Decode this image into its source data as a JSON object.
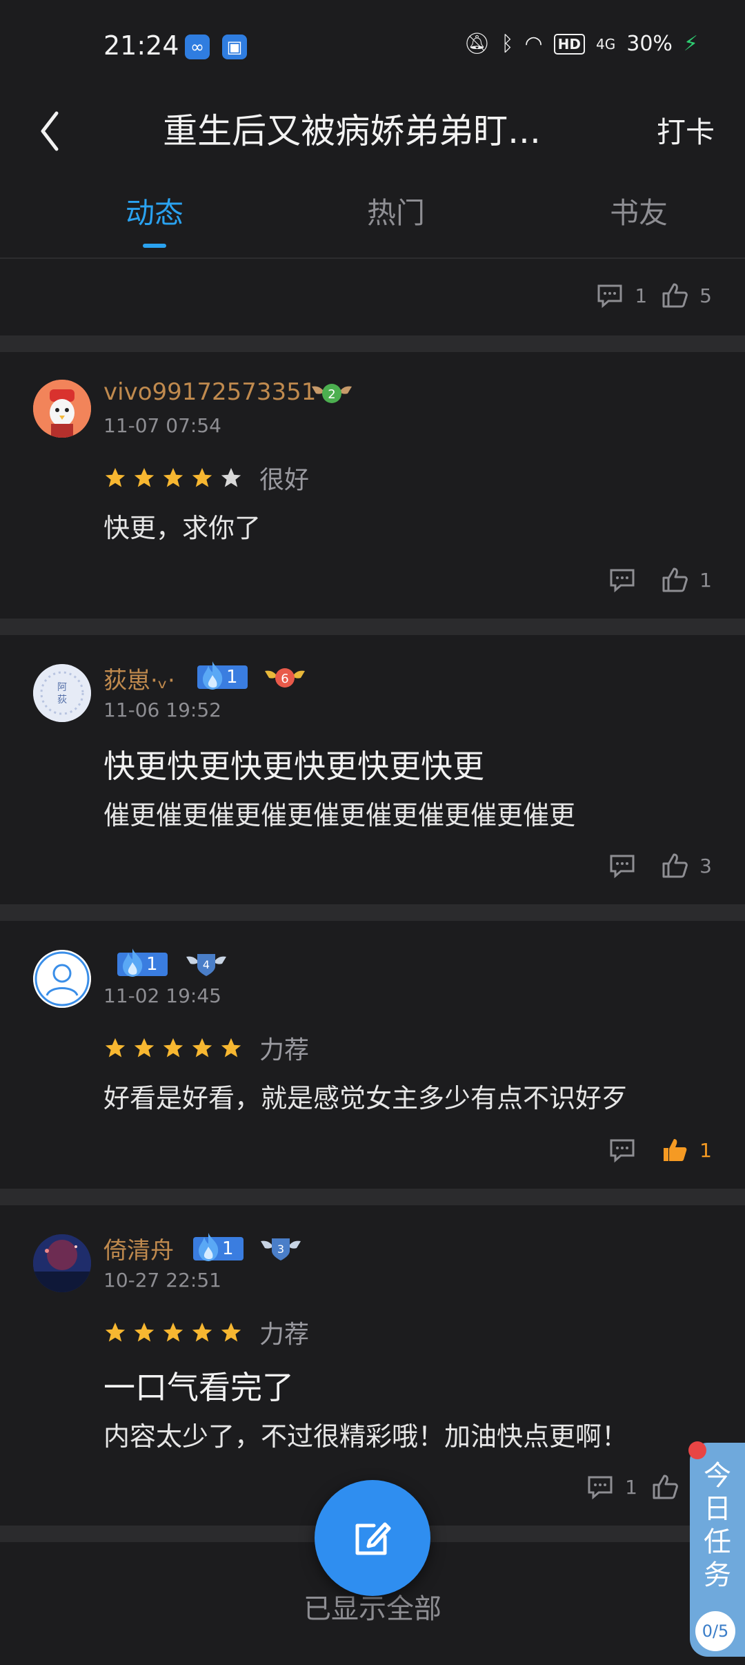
{
  "status_bar": {
    "time": "21:24",
    "battery": "30%",
    "hd": "HD",
    "network": "4G"
  },
  "header": {
    "title": "重生后又被病娇弟弟盯...",
    "checkin": "打卡"
  },
  "tabs": [
    {
      "label": "动态"
    },
    {
      "label": "热门"
    },
    {
      "label": "书友"
    }
  ],
  "top_actions": {
    "comments": "1",
    "likes": "5"
  },
  "posts": [
    {
      "username": "vivo99172573351",
      "date": "11-07 07:54",
      "level": "2",
      "stars": 4,
      "rating_label": "很好",
      "content": "快更，求你了",
      "comments": "",
      "likes": "1"
    },
    {
      "username": "荻崽·ᵥ·",
      "date": "11-06 19:52",
      "flame_level": "1",
      "level": "6",
      "content_title": "快更快更快更快更快更快更",
      "content": "催更催更催更催更催更催更催更催更催更",
      "comments": "",
      "likes": "3"
    },
    {
      "username": "",
      "date": "11-02 19:45",
      "flame_level": "1",
      "level": "4",
      "stars": 5,
      "rating_label": "力荐",
      "content": "好看是好看，就是感觉女主多少有点不识好歹",
      "comments": "",
      "likes": "1"
    },
    {
      "username": "倚清舟",
      "date": "10-27 22:51",
      "flame_level": "1",
      "level": "3",
      "stars": 5,
      "rating_label": "力荐",
      "content_title": "一口气看完了",
      "content": "内容太少了，不过很精彩哦！加油快点更啊！",
      "comments": "1",
      "likes": ""
    }
  ],
  "footer": {
    "text": "已显示全部"
  },
  "task": {
    "label": "今日任务",
    "progress": "0/5"
  },
  "colors": {
    "accent": "#2aa2f0",
    "username": "#c08a4e",
    "star": "#f7b731",
    "liked": "#f59a23"
  }
}
